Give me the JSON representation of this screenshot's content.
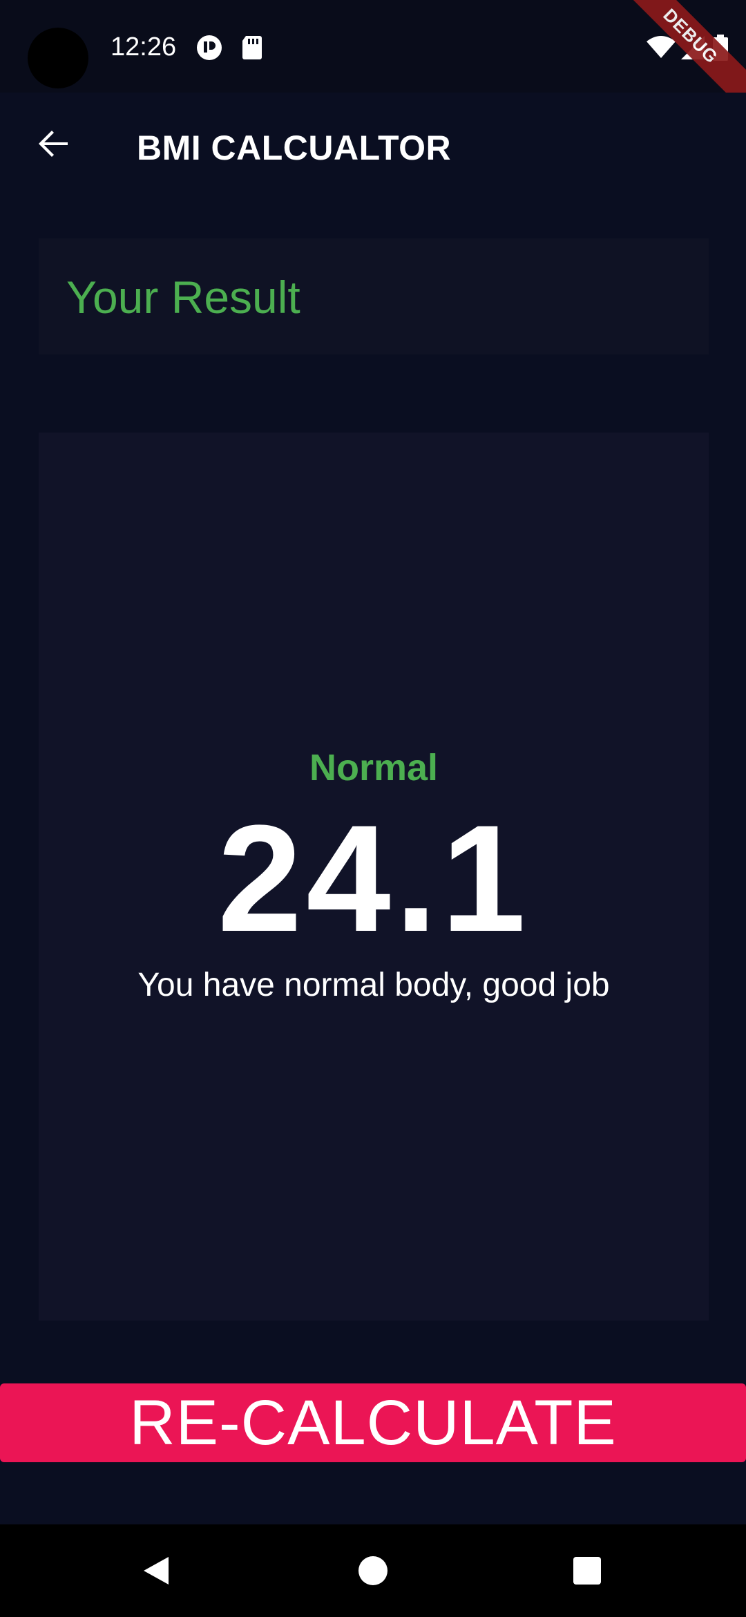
{
  "status_bar": {
    "time": "12:26",
    "icons": [
      "notification-icon",
      "sd-card-icon",
      "wifi-icon",
      "signal-icon",
      "battery-icon"
    ],
    "debug_label": "DEBUG"
  },
  "app_bar": {
    "back_icon": "arrow-back-icon",
    "title": "BMI CALCUALTOR"
  },
  "result_header": {
    "title": "Your Result"
  },
  "result_card": {
    "category": "Normal",
    "bmi_value": "24.1",
    "message": "You have normal body, good job"
  },
  "actions": {
    "recalculate_label": "RE-CALCULATE"
  },
  "nav_bar": {
    "icons": [
      "back-triangle-icon",
      "home-circle-icon",
      "recents-square-icon"
    ]
  },
  "colors": {
    "background": "#0a0e21",
    "card": "#111328",
    "accent_green": "#4caf50",
    "button_pink": "#eb1555",
    "text": "#ffffff"
  }
}
